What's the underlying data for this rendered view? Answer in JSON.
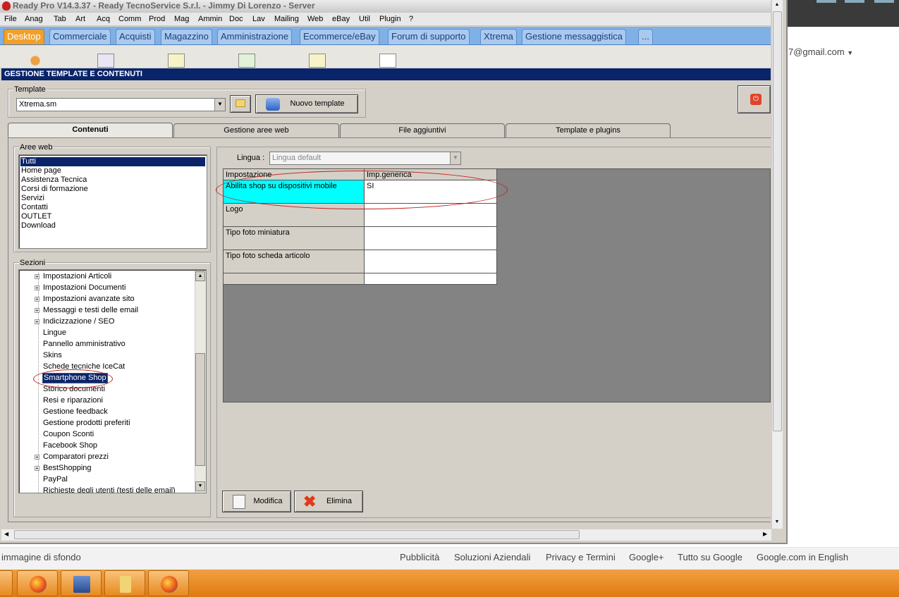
{
  "app": {
    "title": "Ready Pro V14.3.37 - Ready TecnoService S.r.l. - Jimmy Di Lorenzo - Server",
    "menu": [
      "File",
      "Anag",
      "Tab",
      "Art",
      "Acq",
      "Comm",
      "Prod",
      "Mag",
      "Ammin",
      "Doc",
      "Lav",
      "Mailing",
      "Web",
      "eBay",
      "Util",
      "Plugin",
      "?"
    ],
    "tabs": [
      "Desktop",
      "Commerciale",
      "Acquisti",
      "Magazzino",
      "Amministrazione",
      "Ecommerce/eBay",
      "Forum di supporto",
      "Xtrema",
      "Gestione messaggistica",
      "..."
    ],
    "active_tab": "Desktop"
  },
  "panel": {
    "title": "GESTIONE TEMPLATE E CONTENUTI",
    "template_label": "Template",
    "template_value": "Xtrema.sm",
    "new_template_label": "Nuovo template",
    "subtabs": [
      "Contenuti",
      "Gestione aree web",
      "File aggiuntivi",
      "Template e plugins"
    ],
    "active_subtab": "Contenuti",
    "aree_label": "Aree web",
    "aree": [
      "Tutti",
      "Home page",
      "Assistenza Tecnica",
      "Corsi di formazione",
      "Servizi",
      "Contatti",
      "OUTLET",
      "Download"
    ],
    "aree_selected": "Tutti",
    "sezioni_label": "Sezioni",
    "sezioni": [
      {
        "label": "Impostazioni Articoli",
        "expandable": true
      },
      {
        "label": "Impostazioni Documenti",
        "expandable": true
      },
      {
        "label": "Impostazioni avanzate sito",
        "expandable": true
      },
      {
        "label": "Messaggi e testi delle email",
        "expandable": true
      },
      {
        "label": "Indicizzazione / SEO",
        "expandable": true
      },
      {
        "label": "Lingue",
        "expandable": false
      },
      {
        "label": "Pannello amministrativo",
        "expandable": false
      },
      {
        "label": "Skins",
        "expandable": false
      },
      {
        "label": "Schede tecniche IceCat",
        "expandable": false
      },
      {
        "label": "Smartphone Shop",
        "expandable": false
      },
      {
        "label": "Storico documenti",
        "expandable": false
      },
      {
        "label": "Resi e riparazioni",
        "expandable": false
      },
      {
        "label": "Gestione feedback",
        "expandable": false
      },
      {
        "label": "Gestione prodotti preferiti",
        "expandable": false
      },
      {
        "label": "Coupon Sconti",
        "expandable": false
      },
      {
        "label": "Facebook Shop",
        "expandable": false
      },
      {
        "label": "Comparatori prezzi",
        "expandable": true
      },
      {
        "label": "BestShopping",
        "expandable": true
      },
      {
        "label": "PayPal",
        "expandable": false
      },
      {
        "label": "Richieste degli utenti (testi delle email)",
        "expandable": false
      }
    ],
    "sezioni_selected": "Smartphone Shop",
    "lingua_label": "Lingua :",
    "lingua_value": "Lingua default",
    "grid_headers": [
      "Impostazione",
      "Imp.generica"
    ],
    "grid_rows": [
      {
        "name": "Abilita shop su dispositivi mobile",
        "value": "SI",
        "selected": true
      },
      {
        "name": "Logo",
        "value": "",
        "selected": false
      },
      {
        "name": "Tipo foto miniatura",
        "value": "",
        "selected": false
      },
      {
        "name": "Tipo foto scheda articolo",
        "value": "",
        "selected": false
      },
      {
        "name": "",
        "value": "",
        "selected": false
      }
    ],
    "modifica_label": "Modifica",
    "elimina_label": "Elimina"
  },
  "browser": {
    "account": "7@gmail.com",
    "footer_left": "immagine di sfondo",
    "footer_links": [
      "Pubblicità",
      "Soluzioni Aziendali",
      "Privacy e Termini",
      "Google+",
      "Tutto su Google",
      "Google.com in English"
    ]
  },
  "taskbar": {
    "items": [
      "firefox-icon",
      "remote-desktop-icon",
      "folder-icon",
      "firefox-icon"
    ]
  },
  "colors": {
    "highlight": "#00ffff",
    "selection": "#0a246a",
    "annotation": "#c0201c",
    "tab_active": "#f2a02a",
    "tab_bar": "#7fb0e6"
  }
}
